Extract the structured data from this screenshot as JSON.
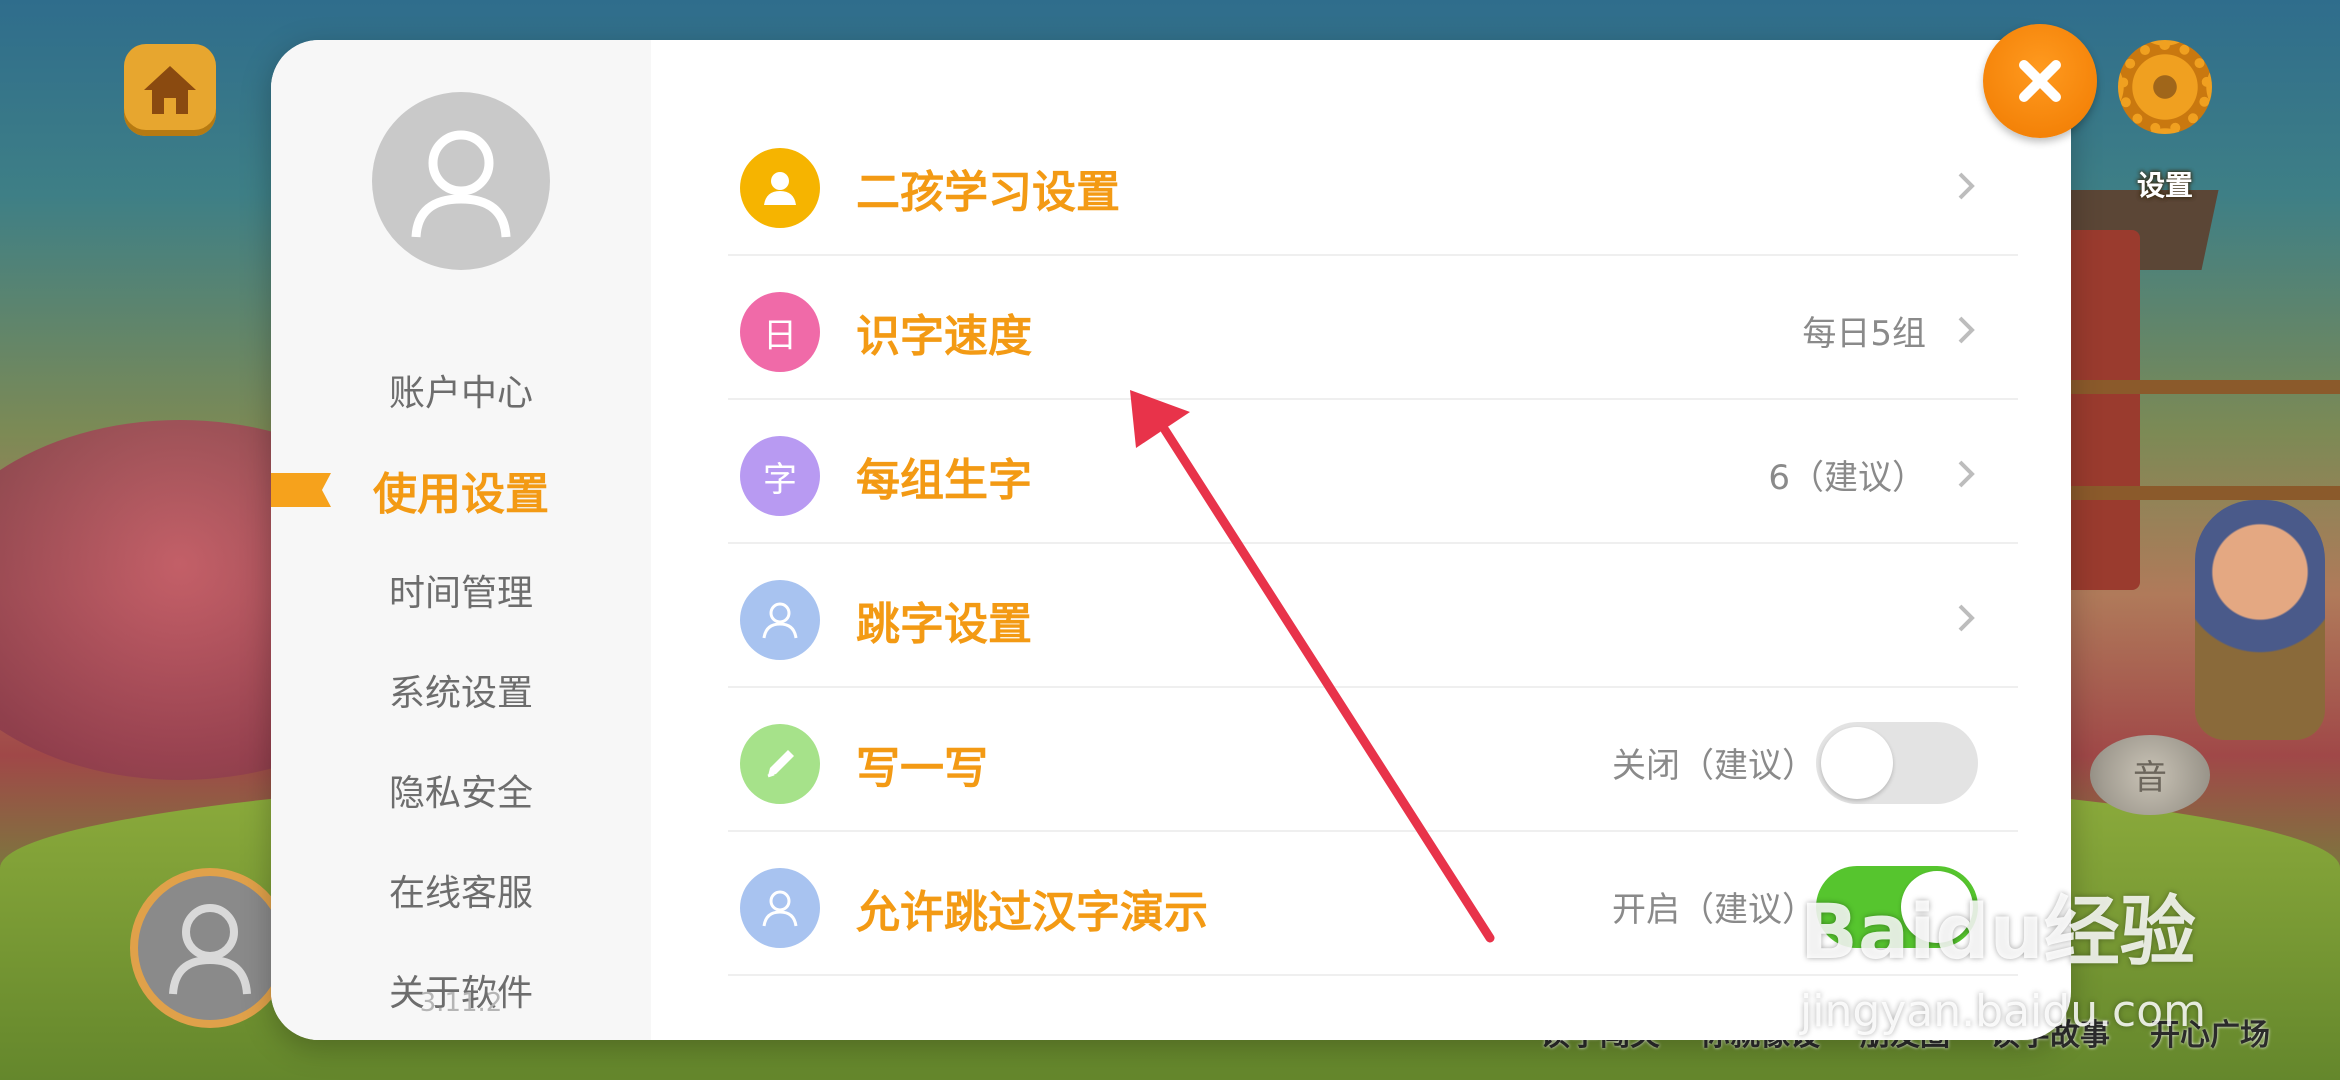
{
  "background": {
    "gear_label": "设置",
    "stump_text": "音",
    "bottom_nav": [
      "读字闯关",
      "你就像设",
      "朋友圈",
      "读字故事",
      "开心广场"
    ]
  },
  "sidebar": {
    "items": [
      {
        "label": "账户中心",
        "active": false
      },
      {
        "label": "使用设置",
        "active": true
      },
      {
        "label": "时间管理",
        "active": false
      },
      {
        "label": "系统设置",
        "active": false
      },
      {
        "label": "隐私安全",
        "active": false
      },
      {
        "label": "在线客服",
        "active": false
      },
      {
        "label": "关于软件",
        "active": false
      }
    ],
    "version": "3.11.2"
  },
  "settings": {
    "rows": [
      {
        "title": "二孩学习设置",
        "value": "",
        "control": "chevron",
        "icon": "person-icon",
        "icon_glyph": "",
        "icon_color": "#f6b400"
      },
      {
        "title": "识字速度",
        "value": "每日5组",
        "control": "chevron",
        "icon": "calendar-icon",
        "icon_glyph": "日",
        "icon_color": "#f06aa8"
      },
      {
        "title": "每组生字",
        "value": "6（建议）",
        "control": "chevron",
        "icon": "character-icon",
        "icon_glyph": "字",
        "icon_color": "#b89af2"
      },
      {
        "title": "跳字设置",
        "value": "",
        "control": "chevron",
        "icon": "person-outline-icon",
        "icon_glyph": "",
        "icon_color": "#a8c3f0"
      },
      {
        "title": "写一写",
        "value": "关闭（建议）",
        "control": "toggle",
        "toggle_on": false,
        "icon": "pen-icon",
        "icon_glyph": "",
        "icon_color": "#a6e28a"
      },
      {
        "title": "允许跳过汉字演示",
        "value": "开启（建议）",
        "control": "toggle",
        "toggle_on": true,
        "icon": "person-outline-icon",
        "icon_glyph": "",
        "icon_color": "#a8c3f0"
      }
    ]
  },
  "watermark": {
    "brand": "Baidu经验",
    "url": "jingyan.baidu.com"
  },
  "colors": {
    "accent": "#f39a14",
    "close": "#f07a00",
    "toggle_on": "#56c52e",
    "arrow": "#e8334a"
  }
}
